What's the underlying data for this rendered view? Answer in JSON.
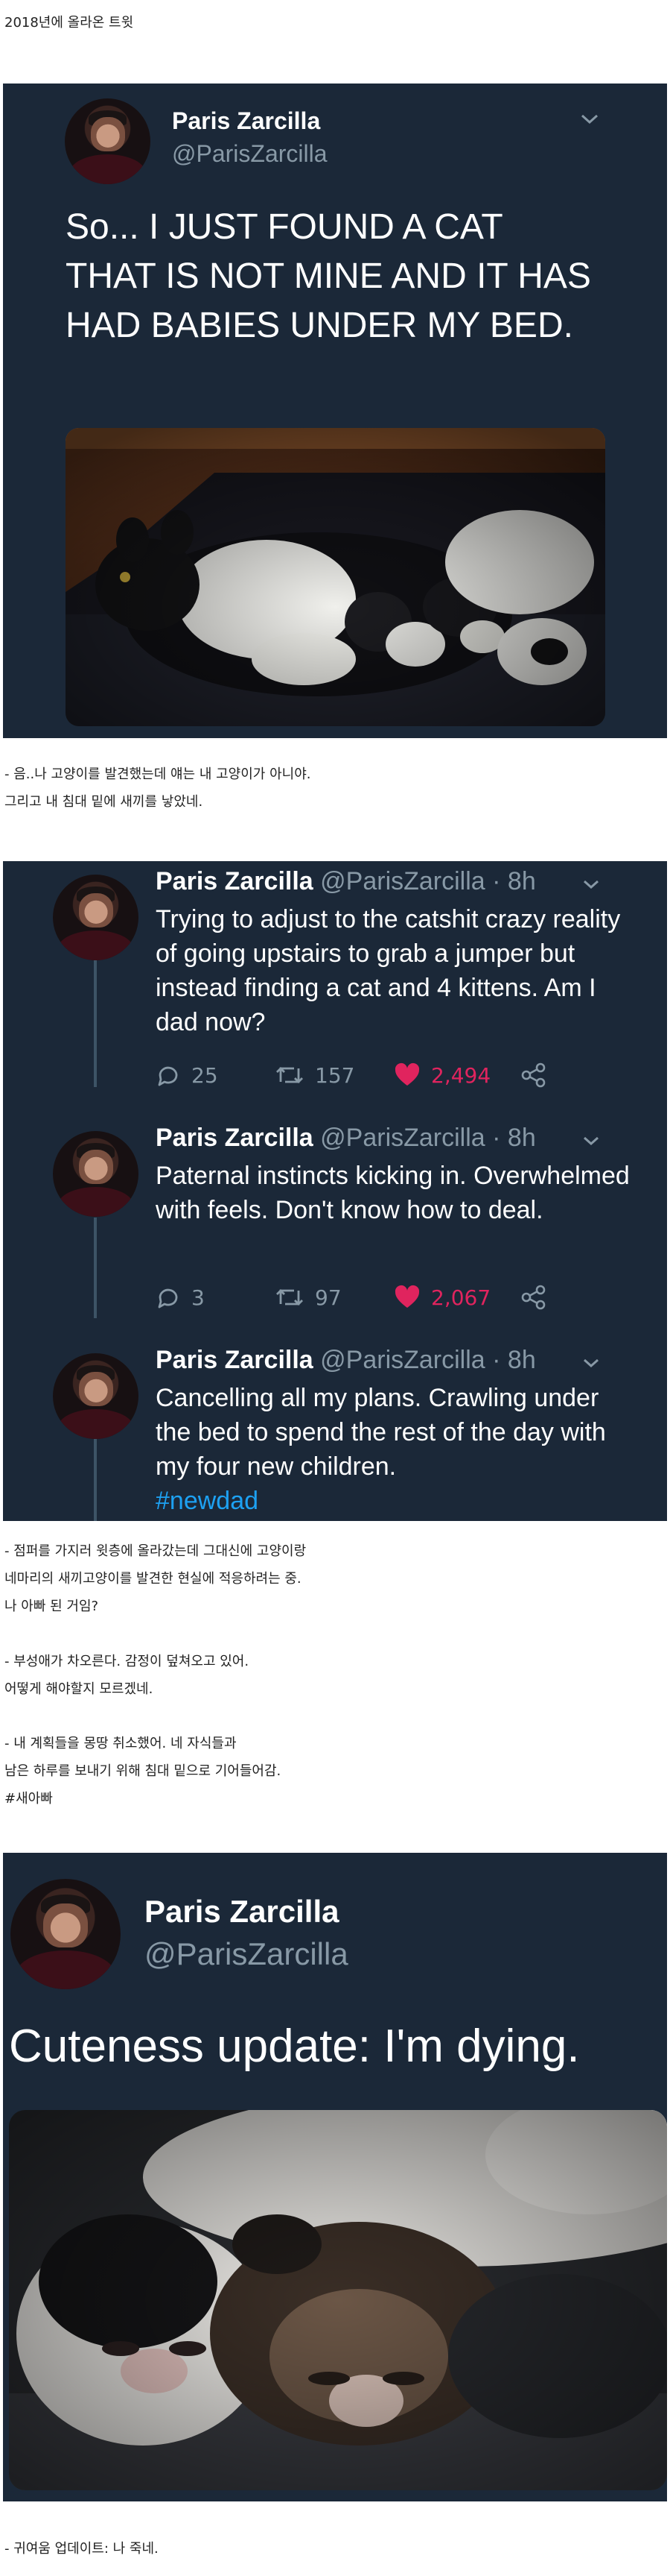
{
  "captions": {
    "top": "2018년에 올라온 트윗",
    "after_tweet1_line1": "- 음..나 고양이를 발견했는데 얘는 내 고양이가 아니야.",
    "after_tweet1_line2": "그리고 내 침대 밑에 새끼를 낳았네.",
    "after_thread_block1": "- 점퍼를 가지러 윗층에 올라갔는데 그대신에 고양이랑\n네마리의 새끼고양이를 발견한 현실에 적응하려는 중.\n나 아빠 된 거임?",
    "after_thread_block2": "- 부성애가 차오른다. 감정이 덮쳐오고 있어.\n어떻게 해야할지 모르겠네.",
    "after_thread_block3": "- 내 계획들을 몽땅 취소했어. 네 자식들과\n남은 하루를 보내기 위해 침대 밑으로 기어들어감.\n#새아빠",
    "bottom": "- 귀여움 업데이트: 나 죽네."
  },
  "tweet1": {
    "name": "Paris Zarcilla",
    "handle": "@ParisZarcilla",
    "text": "So... I JUST FOUND A CAT THAT IS NOT MINE AND IT HAS HAD BABIES UNDER MY BED.",
    "photo_icon": "cat-with-kittens-photo"
  },
  "thread": [
    {
      "name": "Paris Zarcilla",
      "meta": "@ParisZarcilla · 8h",
      "text": "Trying to adjust to the catshit crazy reality of going upstairs to grab a jumper but instead finding a cat and 4 kittens. Am I dad now?",
      "replies": "25",
      "retweets": "157",
      "likes": "2,494"
    },
    {
      "name": "Paris Zarcilla",
      "meta": "@ParisZarcilla · 8h",
      "text": "Paternal instincts kicking in. Overwhelmed with feels. Don't know how to deal.",
      "replies": "3",
      "retweets": "97",
      "likes": "2,067"
    },
    {
      "name": "Paris Zarcilla",
      "meta": "@ParisZarcilla · 8h",
      "text": "Cancelling all my plans. Crawling under the bed to spend the rest of the day with my four new children.",
      "hashtag": "#newdad"
    }
  ],
  "tweet3": {
    "name": "Paris Zarcilla",
    "handle": "@ParisZarcilla",
    "text": "Cuteness update: I'm dying.",
    "photo_icon": "sleeping-kittens-photo"
  },
  "colors": {
    "panel_bg": "#1b2838",
    "like_pink": "#e0245e",
    "hashtag_blue": "#1da1f2",
    "muted": "#8899a6"
  }
}
